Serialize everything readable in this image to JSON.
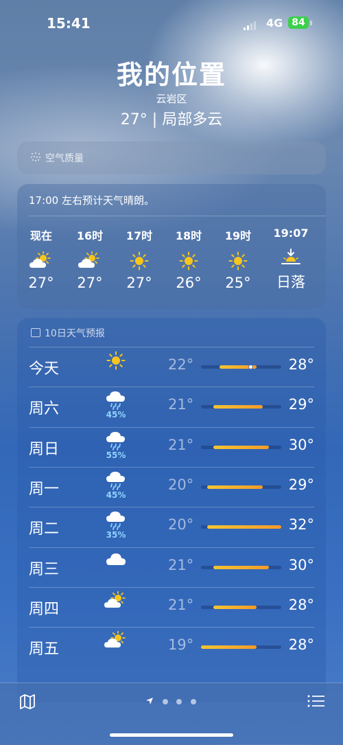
{
  "status": {
    "time": "15:41",
    "network": "4G",
    "battery": "84"
  },
  "header": {
    "location": "我的位置",
    "district": "云岩区",
    "current": "27° | 局部多云"
  },
  "air_quality": {
    "label": "空气质量"
  },
  "hourly": {
    "description": "17:00 左右预计天气晴朗。",
    "items": [
      {
        "time": "现在",
        "icon": "partly-cloudy-icon",
        "temp": "27°"
      },
      {
        "time": "16时",
        "icon": "partly-cloudy-icon",
        "temp": "27°"
      },
      {
        "time": "17时",
        "icon": "sun-icon",
        "temp": "27°"
      },
      {
        "time": "18时",
        "icon": "sun-icon",
        "temp": "26°"
      },
      {
        "time": "19时",
        "icon": "sun-icon",
        "temp": "25°"
      },
      {
        "time": "19:07",
        "icon": "sunset-icon",
        "temp": "日落"
      }
    ]
  },
  "daily": {
    "title": "10日天气预报",
    "range_min": 19,
    "range_max": 32,
    "current_temp": 27,
    "days": [
      {
        "day": "今天",
        "icon": "sun-icon",
        "precip": "",
        "low": "22°",
        "high": "28°",
        "low_v": 22,
        "high_v": 28
      },
      {
        "day": "周六",
        "icon": "rain-icon",
        "precip": "45%",
        "low": "21°",
        "high": "29°",
        "low_v": 21,
        "high_v": 29
      },
      {
        "day": "周日",
        "icon": "rain-icon",
        "precip": "55%",
        "low": "21°",
        "high": "30°",
        "low_v": 21,
        "high_v": 30
      },
      {
        "day": "周一",
        "icon": "rain-icon",
        "precip": "45%",
        "low": "20°",
        "high": "29°",
        "low_v": 20,
        "high_v": 29
      },
      {
        "day": "周二",
        "icon": "rain-icon",
        "precip": "35%",
        "low": "20°",
        "high": "32°",
        "low_v": 20,
        "high_v": 32
      },
      {
        "day": "周三",
        "icon": "cloud-icon",
        "precip": "",
        "low": "21°",
        "high": "30°",
        "low_v": 21,
        "high_v": 30
      },
      {
        "day": "周四",
        "icon": "partly-cloudy-icon",
        "precip": "",
        "low": "21°",
        "high": "28°",
        "low_v": 21,
        "high_v": 28
      },
      {
        "day": "周五",
        "icon": "partly-cloudy-icon",
        "precip": "",
        "low": "19°",
        "high": "28°",
        "low_v": 19,
        "high_v": 28
      }
    ]
  },
  "colors": {
    "sun": "#f7c51e",
    "rain": "#8fd3ff",
    "battery": "#3cd04d"
  }
}
